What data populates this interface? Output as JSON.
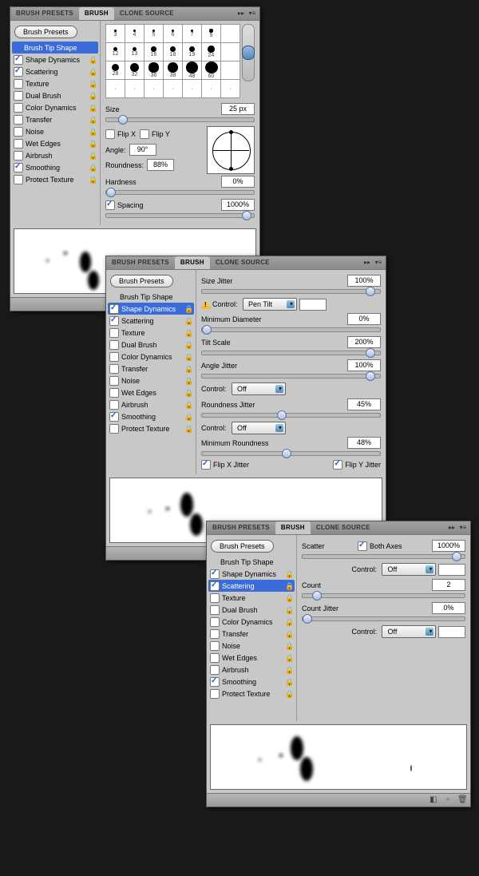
{
  "tabs": {
    "presets": "BRUSH PRESETS",
    "brush": "BRUSH",
    "clone": "CLONE SOURCE"
  },
  "presets_btn": "Brush Presets",
  "side_items": [
    {
      "label": "Brush Tip Shape",
      "chk": null,
      "lock": false,
      "sel": false
    },
    {
      "label": "Shape Dynamics",
      "chk": true,
      "lock": true,
      "sel": false
    },
    {
      "label": "Scattering",
      "chk": true,
      "lock": true,
      "sel": false
    },
    {
      "label": "Texture",
      "chk": false,
      "lock": true,
      "sel": false
    },
    {
      "label": "Dual Brush",
      "chk": false,
      "lock": true,
      "sel": false
    },
    {
      "label": "Color Dynamics",
      "chk": false,
      "lock": true,
      "sel": false
    },
    {
      "label": "Transfer",
      "chk": false,
      "lock": true,
      "sel": false
    },
    {
      "label": "Noise",
      "chk": false,
      "lock": true,
      "sel": false
    },
    {
      "label": "Wet Edges",
      "chk": false,
      "lock": true,
      "sel": false
    },
    {
      "label": "Airbrush",
      "chk": false,
      "lock": true,
      "sel": false
    },
    {
      "label": "Smoothing",
      "chk": true,
      "lock": true,
      "sel": false
    },
    {
      "label": "Protect Texture",
      "chk": false,
      "lock": true,
      "sel": false
    }
  ],
  "p1": {
    "sel_idx": 0,
    "brush_sizes": [
      3,
      4,
      5,
      6,
      7,
      9,
      12,
      13,
      16,
      18,
      19,
      24,
      28,
      32,
      36,
      38,
      48,
      60
    ],
    "size_lbl": "Size",
    "size_val": "25 px",
    "flipx": "Flip X",
    "flipy": "Flip Y",
    "angle_lbl": "Angle:",
    "angle_val": "90°",
    "round_lbl": "Roundness:",
    "round_val": "88%",
    "hard_lbl": "Hardness",
    "hard_val": "0%",
    "spacing_lbl": "Spacing",
    "spacing_val": "1000%"
  },
  "p2": {
    "sel_idx": 1,
    "sjitter_lbl": "Size Jitter",
    "sjitter_val": "100%",
    "control_lbl": "Control:",
    "control1": "Pen Tilt",
    "control1_val": "",
    "mindiam_lbl": "Minimum Diameter",
    "mindiam_val": "0%",
    "tilt_lbl": "Tilt Scale",
    "tilt_val": "200%",
    "ajitter_lbl": "Angle Jitter",
    "ajitter_val": "100%",
    "control2": "Off",
    "rjitter_lbl": "Roundness Jitter",
    "rjitter_val": "45%",
    "control3": "Off",
    "minround_lbl": "Minimum Roundness",
    "minround_val": "48%",
    "flipxj": "Flip X Jitter",
    "flipyj": "Flip Y Jitter"
  },
  "p3": {
    "sel_idx": 2,
    "scatter_lbl": "Scatter",
    "both_axes": "Both Axes",
    "scatter_val": "1000%",
    "control_lbl": "Control:",
    "control1": "Off",
    "control1_val": "",
    "count_lbl": "Count",
    "count_val": "2",
    "cjitter_lbl": "Count Jitter",
    "cjitter_val": "0%",
    "control2": "Off",
    "control2_val": ""
  }
}
